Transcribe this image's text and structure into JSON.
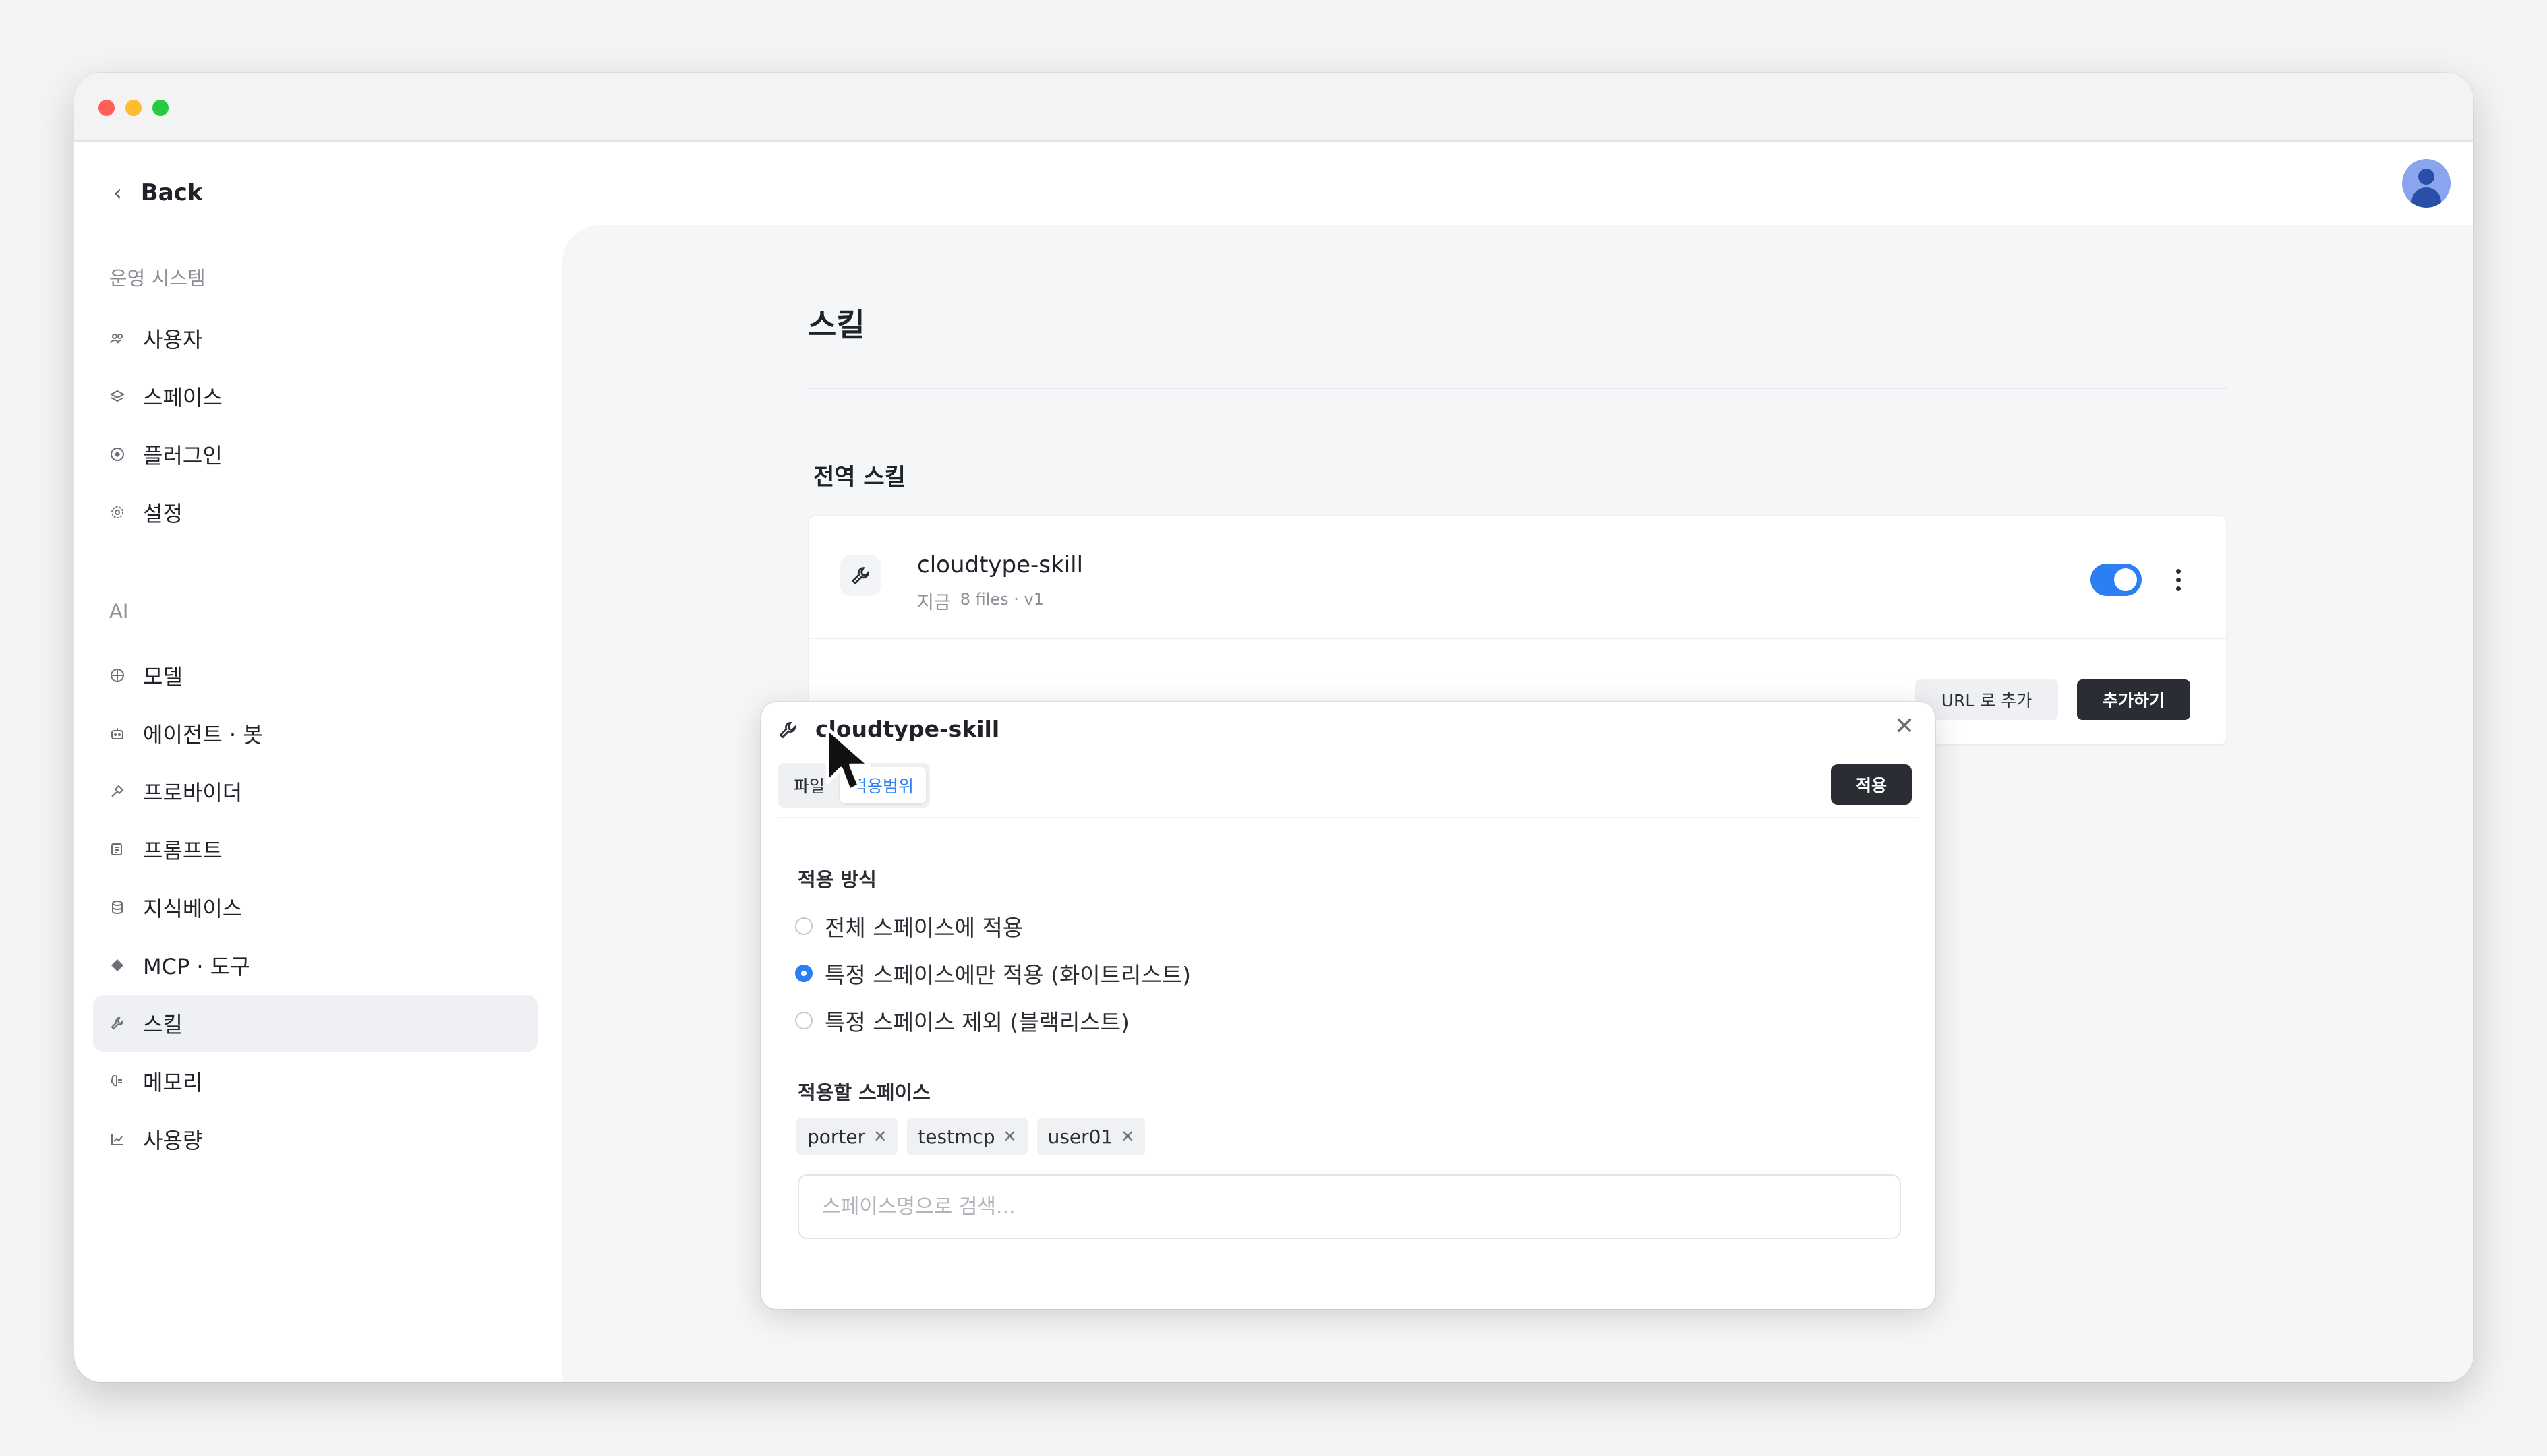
{
  "window": {
    "back_label": "Back"
  },
  "sidebar": {
    "sections": [
      {
        "title": "운영 시스템",
        "items": [
          {
            "label": "사용자",
            "icon": "users-icon"
          },
          {
            "label": "스페이스",
            "icon": "layers-icon"
          },
          {
            "label": "플러그인",
            "icon": "plugin-icon"
          },
          {
            "label": "설정",
            "icon": "gear-icon"
          }
        ]
      },
      {
        "title": "AI",
        "items": [
          {
            "label": "모델",
            "icon": "model-icon"
          },
          {
            "label": "에이전트 · 봇",
            "icon": "bot-icon"
          },
          {
            "label": "프로바이더",
            "icon": "provider-icon"
          },
          {
            "label": "프롬프트",
            "icon": "prompt-icon"
          },
          {
            "label": "지식베이스",
            "icon": "database-icon"
          },
          {
            "label": "MCP · 도구",
            "icon": "tool-icon"
          },
          {
            "label": "스킬",
            "icon": "wrench-icon",
            "active": true
          },
          {
            "label": "메모리",
            "icon": "memory-icon"
          },
          {
            "label": "사용량",
            "icon": "chart-icon"
          }
        ]
      }
    ]
  },
  "main": {
    "title": "스킬",
    "section_title": "전역 스킬",
    "skill": {
      "name": "cloudtype-skill",
      "time": "지금",
      "meta": "8 files · v1",
      "enabled": true
    },
    "buttons": {
      "add_url": "URL 로 추가",
      "add": "추가하기"
    }
  },
  "popup": {
    "title": "cloudtype-skill",
    "tabs": [
      {
        "label": "파일",
        "active": false
      },
      {
        "label": "적용범위",
        "active": true
      }
    ],
    "apply_label": "적용",
    "mode_label": "적용 방식",
    "modes": [
      {
        "label": "전체 스페이스에 적용",
        "checked": false
      },
      {
        "label": "특정 스페이스에만 적용 (화이트리스트)",
        "checked": true
      },
      {
        "label": "특정 스페이스 제외 (블랙리스트)",
        "checked": false
      }
    ],
    "spaces_label": "적용할 스페이스",
    "spaces": [
      "porter",
      "testmcp",
      "user01"
    ],
    "search_placeholder": "스페이스명으로 검색..."
  },
  "colors": {
    "accent": "#2b7ff2",
    "dark_button": "#2a2d33",
    "sidebar_active": "#eef0f3"
  }
}
